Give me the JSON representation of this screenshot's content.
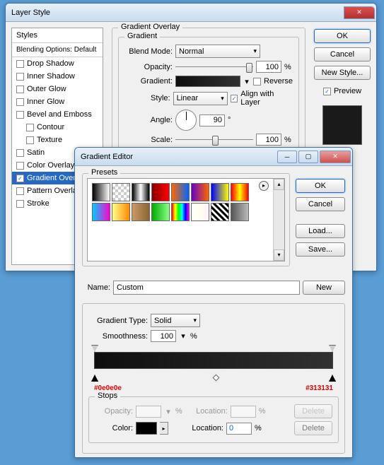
{
  "layerStyle": {
    "title": "Layer Style",
    "styles": {
      "header": "Styles",
      "blending": "Blending Options: Default",
      "items": [
        {
          "label": "Drop Shadow",
          "checked": false,
          "indent": false
        },
        {
          "label": "Inner Shadow",
          "checked": false,
          "indent": false
        },
        {
          "label": "Outer Glow",
          "checked": false,
          "indent": false
        },
        {
          "label": "Inner Glow",
          "checked": false,
          "indent": false
        },
        {
          "label": "Bevel and Emboss",
          "checked": false,
          "indent": false
        },
        {
          "label": "Contour",
          "checked": false,
          "indent": true
        },
        {
          "label": "Texture",
          "checked": false,
          "indent": true
        },
        {
          "label": "Satin",
          "checked": false,
          "indent": false
        },
        {
          "label": "Color Overlay",
          "checked": false,
          "indent": false
        },
        {
          "label": "Gradient Overlay",
          "checked": true,
          "indent": false,
          "selected": true
        },
        {
          "label": "Pattern Overlay",
          "checked": false,
          "indent": false
        },
        {
          "label": "Stroke",
          "checked": false,
          "indent": false
        }
      ]
    },
    "panel": {
      "legend": "Gradient Overlay",
      "sublegend": "Gradient",
      "blendModeLabel": "Blend Mode:",
      "blendMode": "Normal",
      "opacityLabel": "Opacity:",
      "opacity": "100",
      "pct": "%",
      "gradientLabel": "Gradient:",
      "reverseLabel": "Reverse",
      "styleLabel": "Style:",
      "style": "Linear",
      "alignLabel": "Align with Layer",
      "alignChecked": true,
      "angleLabel": "Angle:",
      "angle": "90",
      "deg": "°",
      "scaleLabel": "Scale:",
      "scale": "100"
    },
    "buttons": {
      "ok": "OK",
      "cancel": "Cancel",
      "newStyle": "New Style...",
      "previewLabel": "Preview",
      "previewChecked": true
    }
  },
  "gradientEditor": {
    "title": "Gradient Editor",
    "presetsLabel": "Presets",
    "presets": [
      "linear-gradient(to right,#000,#fff)",
      "repeating-conic-gradient(#ccc 0 25%,#fff 0 50%) 0/8px 8px",
      "linear-gradient(to right,#000,#fff,#000)",
      "linear-gradient(to right,#800,#f00)",
      "linear-gradient(to right,#f60,#06f)",
      "linear-gradient(to right,#60c,#f60)",
      "linear-gradient(to right,#00f,#ff0)",
      "linear-gradient(to right,#f00,#ff0,#f00)",
      "linear-gradient(to right,#0cf,#f0c)",
      "linear-gradient(to right,#ff8,#f80)",
      "linear-gradient(to right,#c96,#863)",
      "linear-gradient(to right,#0a0,#8f8)",
      "linear-gradient(to right,#f00,#ff0,#0f0,#0ff,#00f,#f0f)",
      "linear-gradient(to right,#fff,#ffe,#fef)",
      "repeating-linear-gradient(45deg,#000 0 3px,#fff 3px 6px)",
      "linear-gradient(to right,#555,#bbb)"
    ],
    "buttons": {
      "ok": "OK",
      "cancel": "Cancel",
      "load": "Load...",
      "save": "Save...",
      "new": "New",
      "delete": "Delete"
    },
    "nameLabel": "Name:",
    "name": "Custom",
    "gradTypeLabel": "Gradient Type:",
    "gradType": "Solid",
    "smoothLabel": "Smoothness:",
    "smoothness": "100",
    "pct": "%",
    "hexLeft": "#0e0e0e",
    "hexRight": "#313131",
    "stops": {
      "legend": "Stops",
      "opacityLabel": "Opacity:",
      "locationLabel": "Location:",
      "colorLabel": "Color:",
      "locationValue": "0"
    }
  }
}
